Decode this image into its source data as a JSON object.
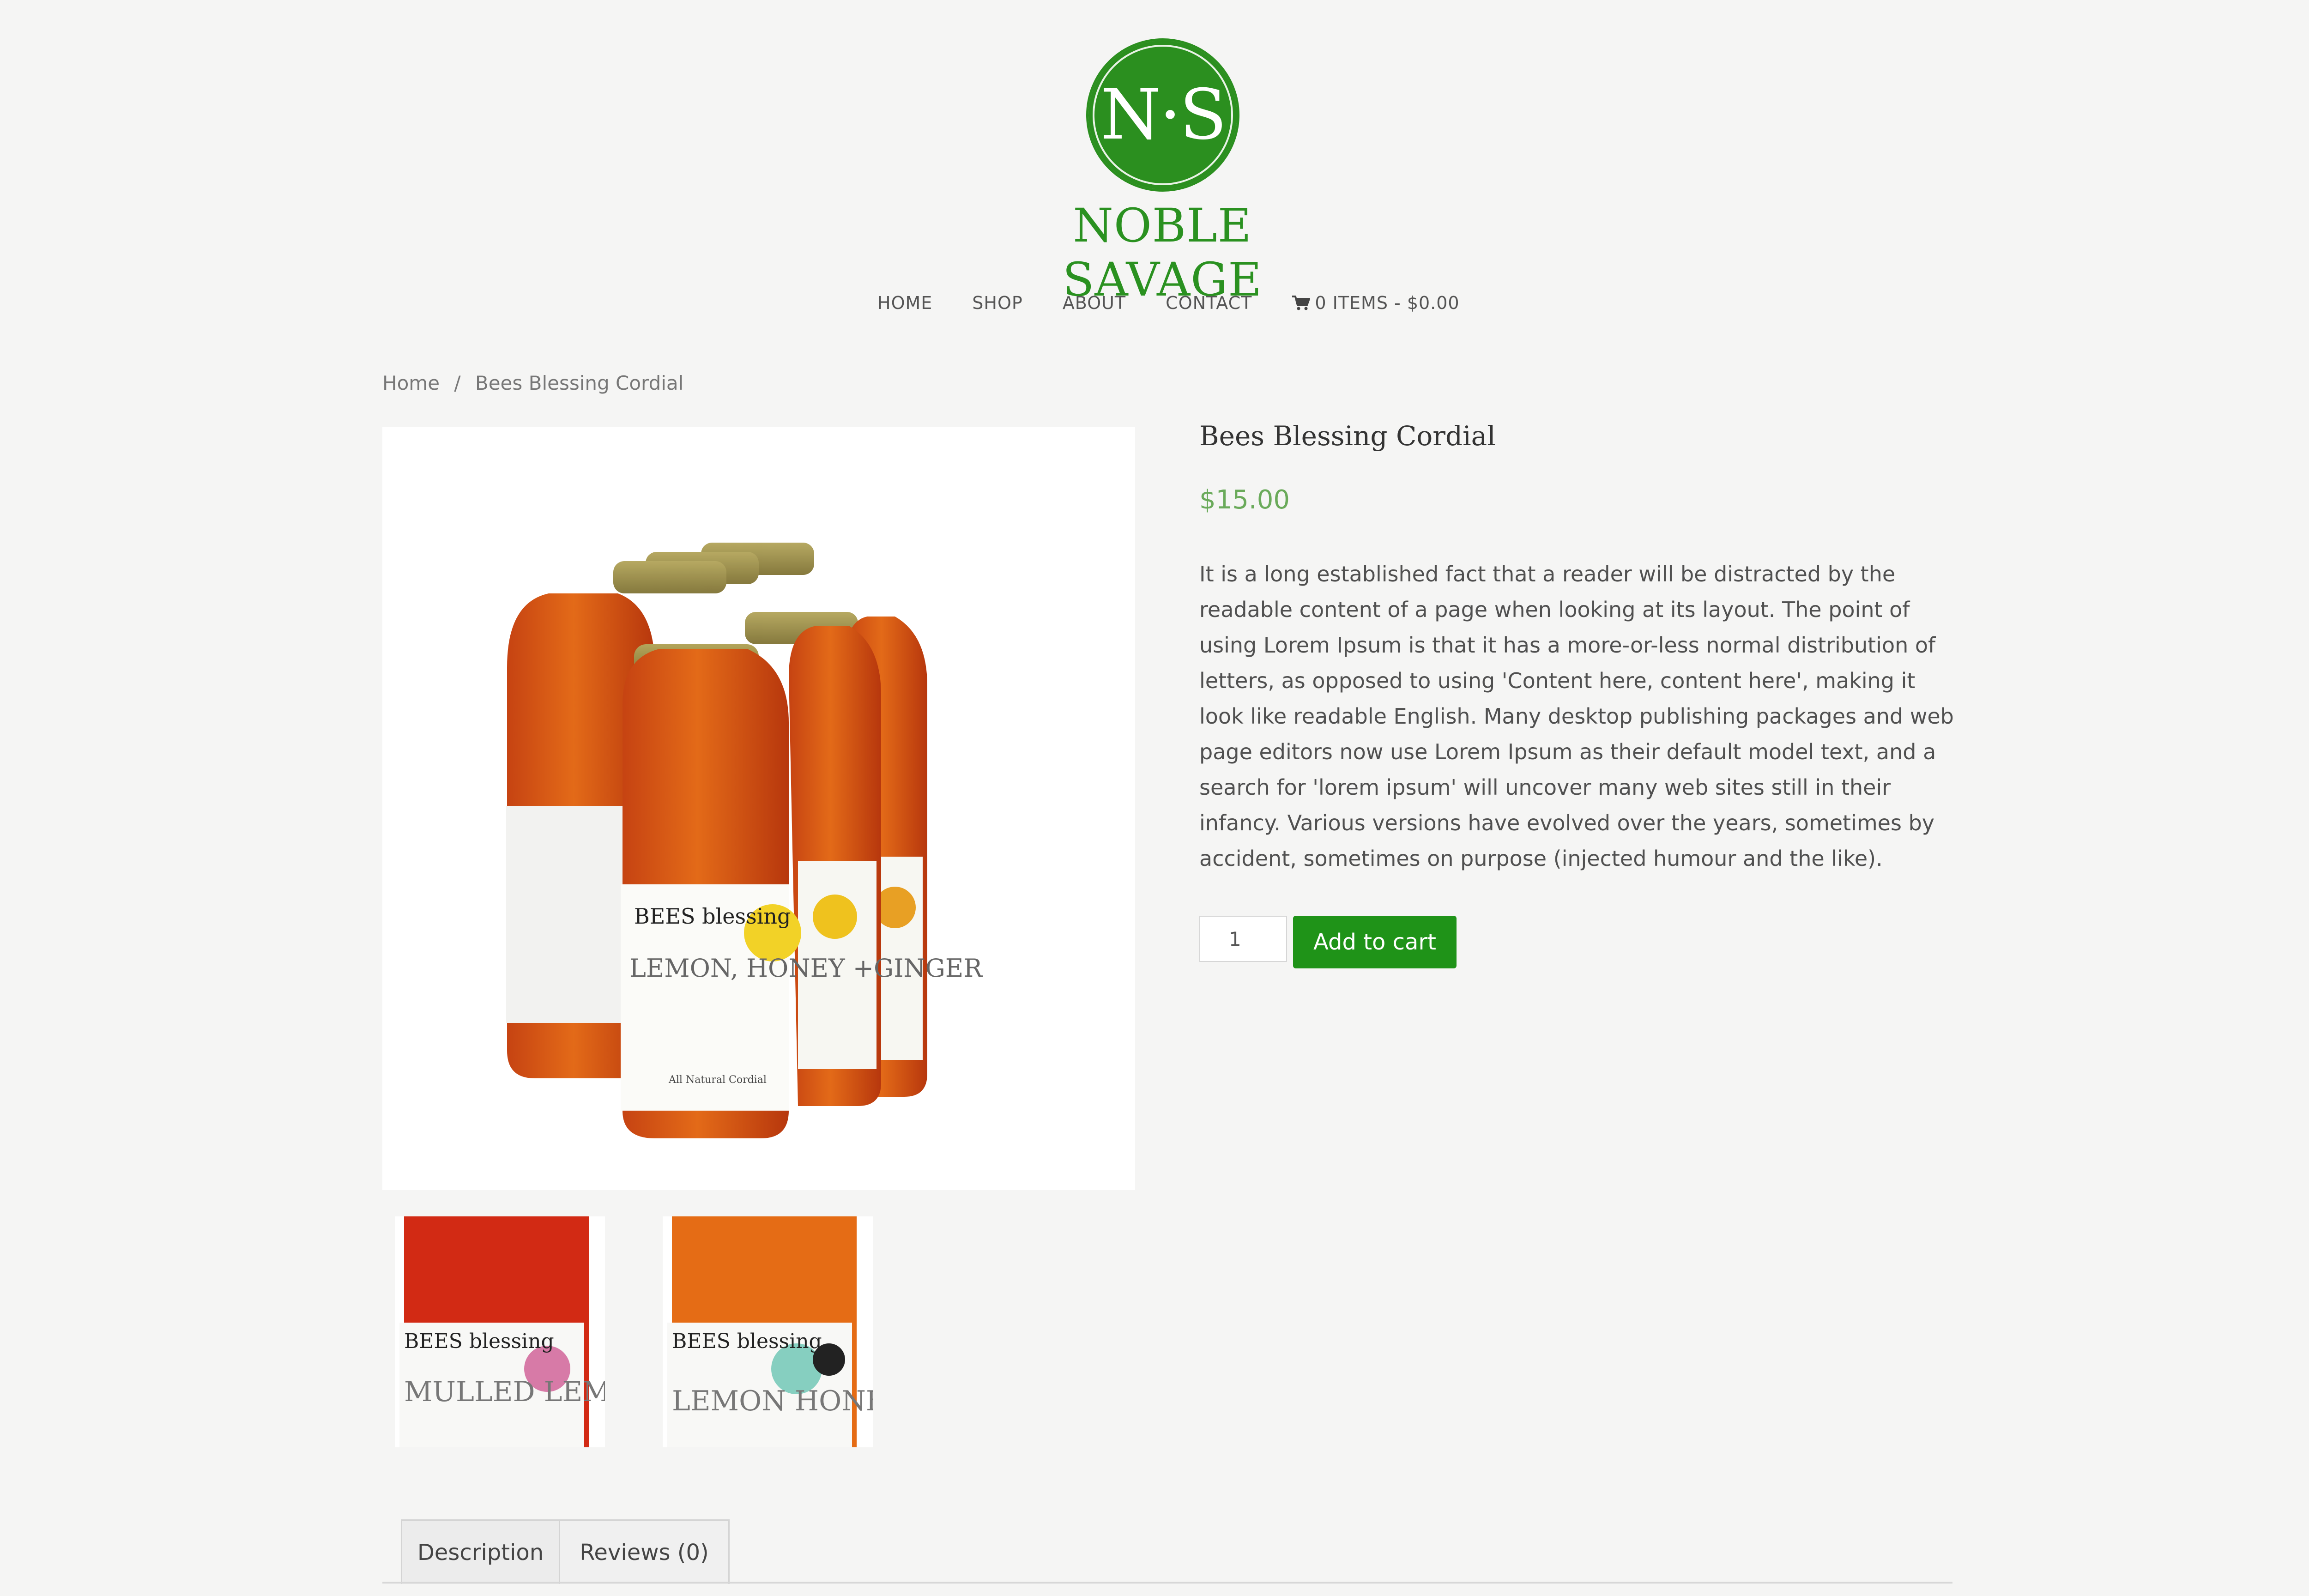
{
  "brand": {
    "monogram": "N·S",
    "name": "NOBLE SAVAGE",
    "green": "#2b8f1f"
  },
  "nav": {
    "items": [
      "HOME",
      "SHOP",
      "ABOUT",
      "CONTACT"
    ],
    "cart_label": "0 ITEMS - $0.00",
    "cart_icon": "cart-icon"
  },
  "breadcrumb": {
    "home": "Home",
    "separator": "/",
    "current": "Bees Blessing Cordial"
  },
  "product": {
    "title": "Bees Blessing Cordial",
    "price": "$15.00",
    "description": "It is a long established fact that a reader will be distracted by the readable content of a page when looking at its layout. The point of using Lorem Ipsum is that it has a more-or-less normal distribution of letters, as opposed to using 'Content here, content here', making it look like readable English. Many desktop publishing packages and web page editors now use Lorem Ipsum as their default model text, and a search for 'lorem ipsum' will uncover many web sites still in their infancy. Various versions have evolved over the years, sometimes by accident, sometimes on purpose (injected humour and the like).",
    "quantity": "1",
    "add_to_cart": "Add to cart",
    "main_image": {
      "label_brand": "BEES blessing",
      "label_flavor": "LEMON, HONEY +GINGER",
      "label_sub": "All Natural Cordial"
    },
    "thumbnails": [
      {
        "brand": "BEES blessing",
        "flavor": "MULLED LEMON",
        "dot": "#d77aa7"
      },
      {
        "brand": "BEES blessing",
        "flavor": "LEMON HONEY",
        "dot": "#86cfc0"
      }
    ]
  },
  "tabs": {
    "description": "Description",
    "reviews": "Reviews (0)"
  }
}
